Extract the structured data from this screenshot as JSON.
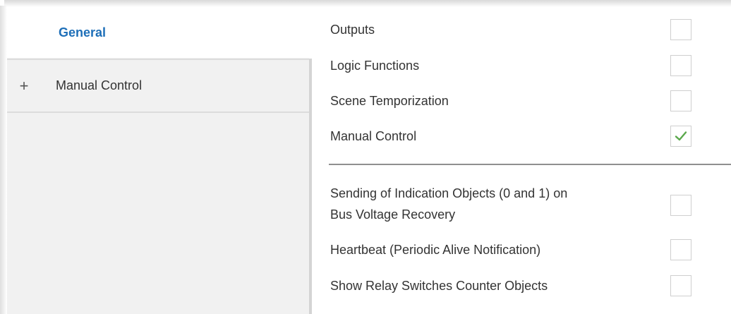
{
  "sidebar": {
    "items": [
      {
        "label": "General",
        "selected": true
      },
      {
        "label": "Manual Control",
        "expander": "+"
      }
    ]
  },
  "settings": {
    "group1": [
      {
        "label": "Outputs",
        "checked": false
      },
      {
        "label": "Logic Functions",
        "checked": false
      },
      {
        "label": "Scene Temporization",
        "checked": false
      },
      {
        "label": "Manual Control",
        "checked": true
      }
    ],
    "group2": [
      {
        "label_line1": "Sending of Indication Objects (0 and 1) on",
        "label_line2": "Bus Voltage Recovery",
        "checked": false
      },
      {
        "label": "Heartbeat (Periodic Alive Notification)",
        "checked": false
      },
      {
        "label": "Show Relay Switches Counter Objects",
        "checked": false
      }
    ]
  },
  "colors": {
    "accent": "#1e6fb8",
    "check": "#5aa84b",
    "sidebar_bg": "#f1f1f1"
  },
  "icons": {
    "expand": "plus-icon",
    "checked": "checkmark-icon"
  }
}
